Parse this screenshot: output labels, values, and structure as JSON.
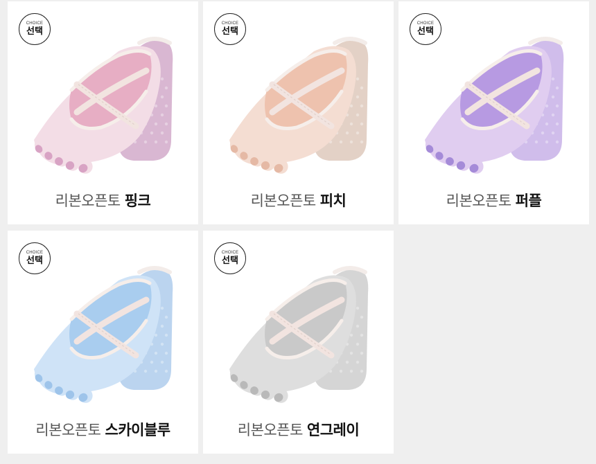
{
  "badge": {
    "top_text": "CHOICE",
    "main_text": "선택"
  },
  "products": [
    {
      "prefix": "리본오픈토",
      "color_name": "핑크",
      "colors": {
        "sock": "#f3dde6",
        "inner": "#e7aec4",
        "sole": "#d7b3d0",
        "toe": "#d8a3c4"
      }
    },
    {
      "prefix": "리본오픈토",
      "color_name": "피치",
      "colors": {
        "sock": "#f4ddd2",
        "inner": "#eec2ae",
        "sole": "#e1cfc3",
        "toe": "#e5b9a5"
      }
    },
    {
      "prefix": "리본오픈토",
      "color_name": "퍼플",
      "colors": {
        "sock": "#e0cdf0",
        "inner": "#b79ae2",
        "sole": "#cdb9ea",
        "toe": "#a58bd8"
      }
    },
    {
      "prefix": "리본오픈토",
      "color_name": "스카이블루",
      "colors": {
        "sock": "#cfe3f7",
        "inner": "#a9cdef",
        "sole": "#b7d2ee",
        "toe": "#9ec4ea"
      }
    },
    {
      "prefix": "리본오픈토",
      "color_name": "연그레이",
      "colors": {
        "sock": "#dedede",
        "inner": "#c9c9c9",
        "sole": "#d3d3d3",
        "toe": "#b9b9b9"
      }
    }
  ]
}
